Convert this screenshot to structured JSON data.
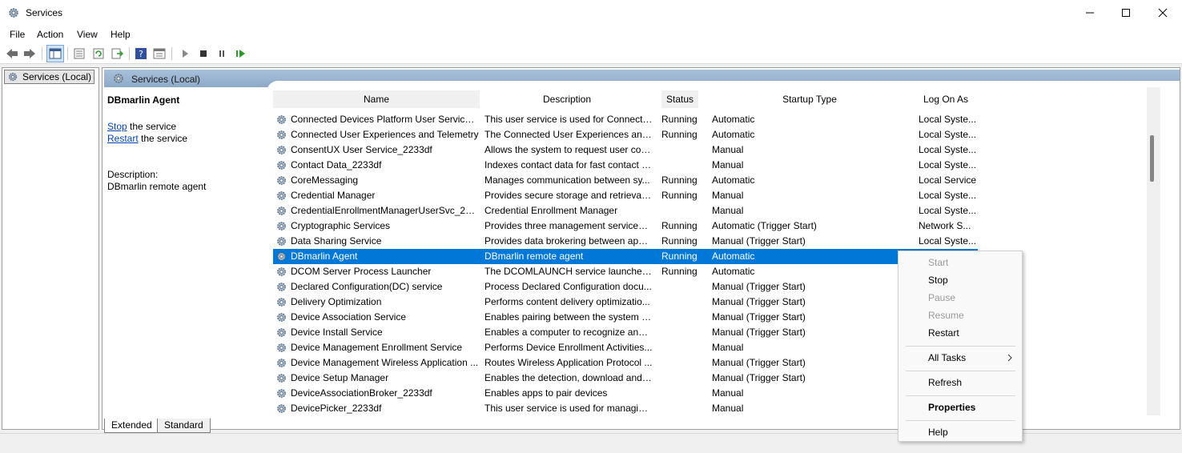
{
  "window": {
    "title": "Services"
  },
  "menu": [
    "File",
    "Action",
    "View",
    "Help"
  ],
  "tree": {
    "root": "Services (Local)"
  },
  "content": {
    "header": "Services (Local)"
  },
  "detail": {
    "service_name": "DBmarlin Agent",
    "stop_link": "Stop",
    "stop_suffix": " the service",
    "restart_link": "Restart",
    "restart_suffix": " the service",
    "description_label": "Description:",
    "description": "DBmarlin remote agent"
  },
  "columns": {
    "name": "Name",
    "description": "Description",
    "status": "Status",
    "startup": "Startup Type",
    "logon": "Log On As"
  },
  "rows": [
    {
      "name": "Connected Devices Platform User Service_...",
      "description": "This user service is used for Connecte...",
      "status": "Running",
      "startup": "Automatic",
      "logon": "Local Syste..."
    },
    {
      "name": "Connected User Experiences and Telemetry",
      "description": "The Connected User Experiences and ...",
      "status": "Running",
      "startup": "Automatic",
      "logon": "Local Syste..."
    },
    {
      "name": "ConsentUX User Service_2233df",
      "description": "Allows the system to request user con...",
      "status": "",
      "startup": "Manual",
      "logon": "Local Syste..."
    },
    {
      "name": "Contact Data_2233df",
      "description": "Indexes contact data for fast contact s...",
      "status": "",
      "startup": "Manual",
      "logon": "Local Syste..."
    },
    {
      "name": "CoreMessaging",
      "description": "Manages communication between sy...",
      "status": "Running",
      "startup": "Automatic",
      "logon": "Local Service"
    },
    {
      "name": "Credential Manager",
      "description": "Provides secure storage and retrieval ...",
      "status": "Running",
      "startup": "Manual",
      "logon": "Local Syste..."
    },
    {
      "name": "CredentialEnrollmentManagerUserSvc_223...",
      "description": "Credential Enrollment Manager",
      "status": "",
      "startup": "Manual",
      "logon": "Local Syste..."
    },
    {
      "name": "Cryptographic Services",
      "description": "Provides three management services: ...",
      "status": "Running",
      "startup": "Automatic (Trigger Start)",
      "logon": "Network S..."
    },
    {
      "name": "Data Sharing Service",
      "description": "Provides data brokering between appl...",
      "status": "Running",
      "startup": "Manual (Trigger Start)",
      "logon": "Local Syste..."
    },
    {
      "name": "DBmarlin Agent",
      "description": "DBmarlin remote agent",
      "status": "Running",
      "startup": "Automatic",
      "logon": "Local Syste..."
    },
    {
      "name": "DCOM Server Process Launcher",
      "description": "The DCOMLAUNCH service launches ...",
      "status": "Running",
      "startup": "Automatic",
      "logon": ""
    },
    {
      "name": "Declared Configuration(DC) service",
      "description": "Process Declared Configuration docu...",
      "status": "",
      "startup": "Manual (Trigger Start)",
      "logon": ""
    },
    {
      "name": "Delivery Optimization",
      "description": "Performs content delivery optimizatio...",
      "status": "",
      "startup": "Manual (Trigger Start)",
      "logon": ""
    },
    {
      "name": "Device Association Service",
      "description": "Enables pairing between the system a...",
      "status": "",
      "startup": "Manual (Trigger Start)",
      "logon": ""
    },
    {
      "name": "Device Install Service",
      "description": "Enables a computer to recognize and ...",
      "status": "",
      "startup": "Manual (Trigger Start)",
      "logon": ""
    },
    {
      "name": "Device Management Enrollment Service",
      "description": "Performs Device Enrollment Activities...",
      "status": "",
      "startup": "Manual",
      "logon": ""
    },
    {
      "name": "Device Management Wireless Application ...",
      "description": "Routes Wireless Application Protocol ...",
      "status": "",
      "startup": "Manual (Trigger Start)",
      "logon": ""
    },
    {
      "name": "Device Setup Manager",
      "description": "Enables the detection, download and ...",
      "status": "",
      "startup": "Manual (Trigger Start)",
      "logon": ""
    },
    {
      "name": "DeviceAssociationBroker_2233df",
      "description": "Enables apps to pair devices",
      "status": "",
      "startup": "Manual",
      "logon": ""
    },
    {
      "name": "DevicePicker_2233df",
      "description": "This user service is used for managing...",
      "status": "",
      "startup": "Manual",
      "logon": ""
    }
  ],
  "selected_row": "DBmarlin Agent",
  "tabs": [
    "Extended",
    "Standard"
  ],
  "context_menu": {
    "start": "Start",
    "stop": "Stop",
    "pause": "Pause",
    "resume": "Resume",
    "restart": "Restart",
    "all_tasks": "All Tasks",
    "refresh": "Refresh",
    "properties": "Properties",
    "help": "Help"
  },
  "colors": {
    "selection": "#0078d7",
    "header_band": "#9db6d3",
    "link": "#0645ad"
  }
}
